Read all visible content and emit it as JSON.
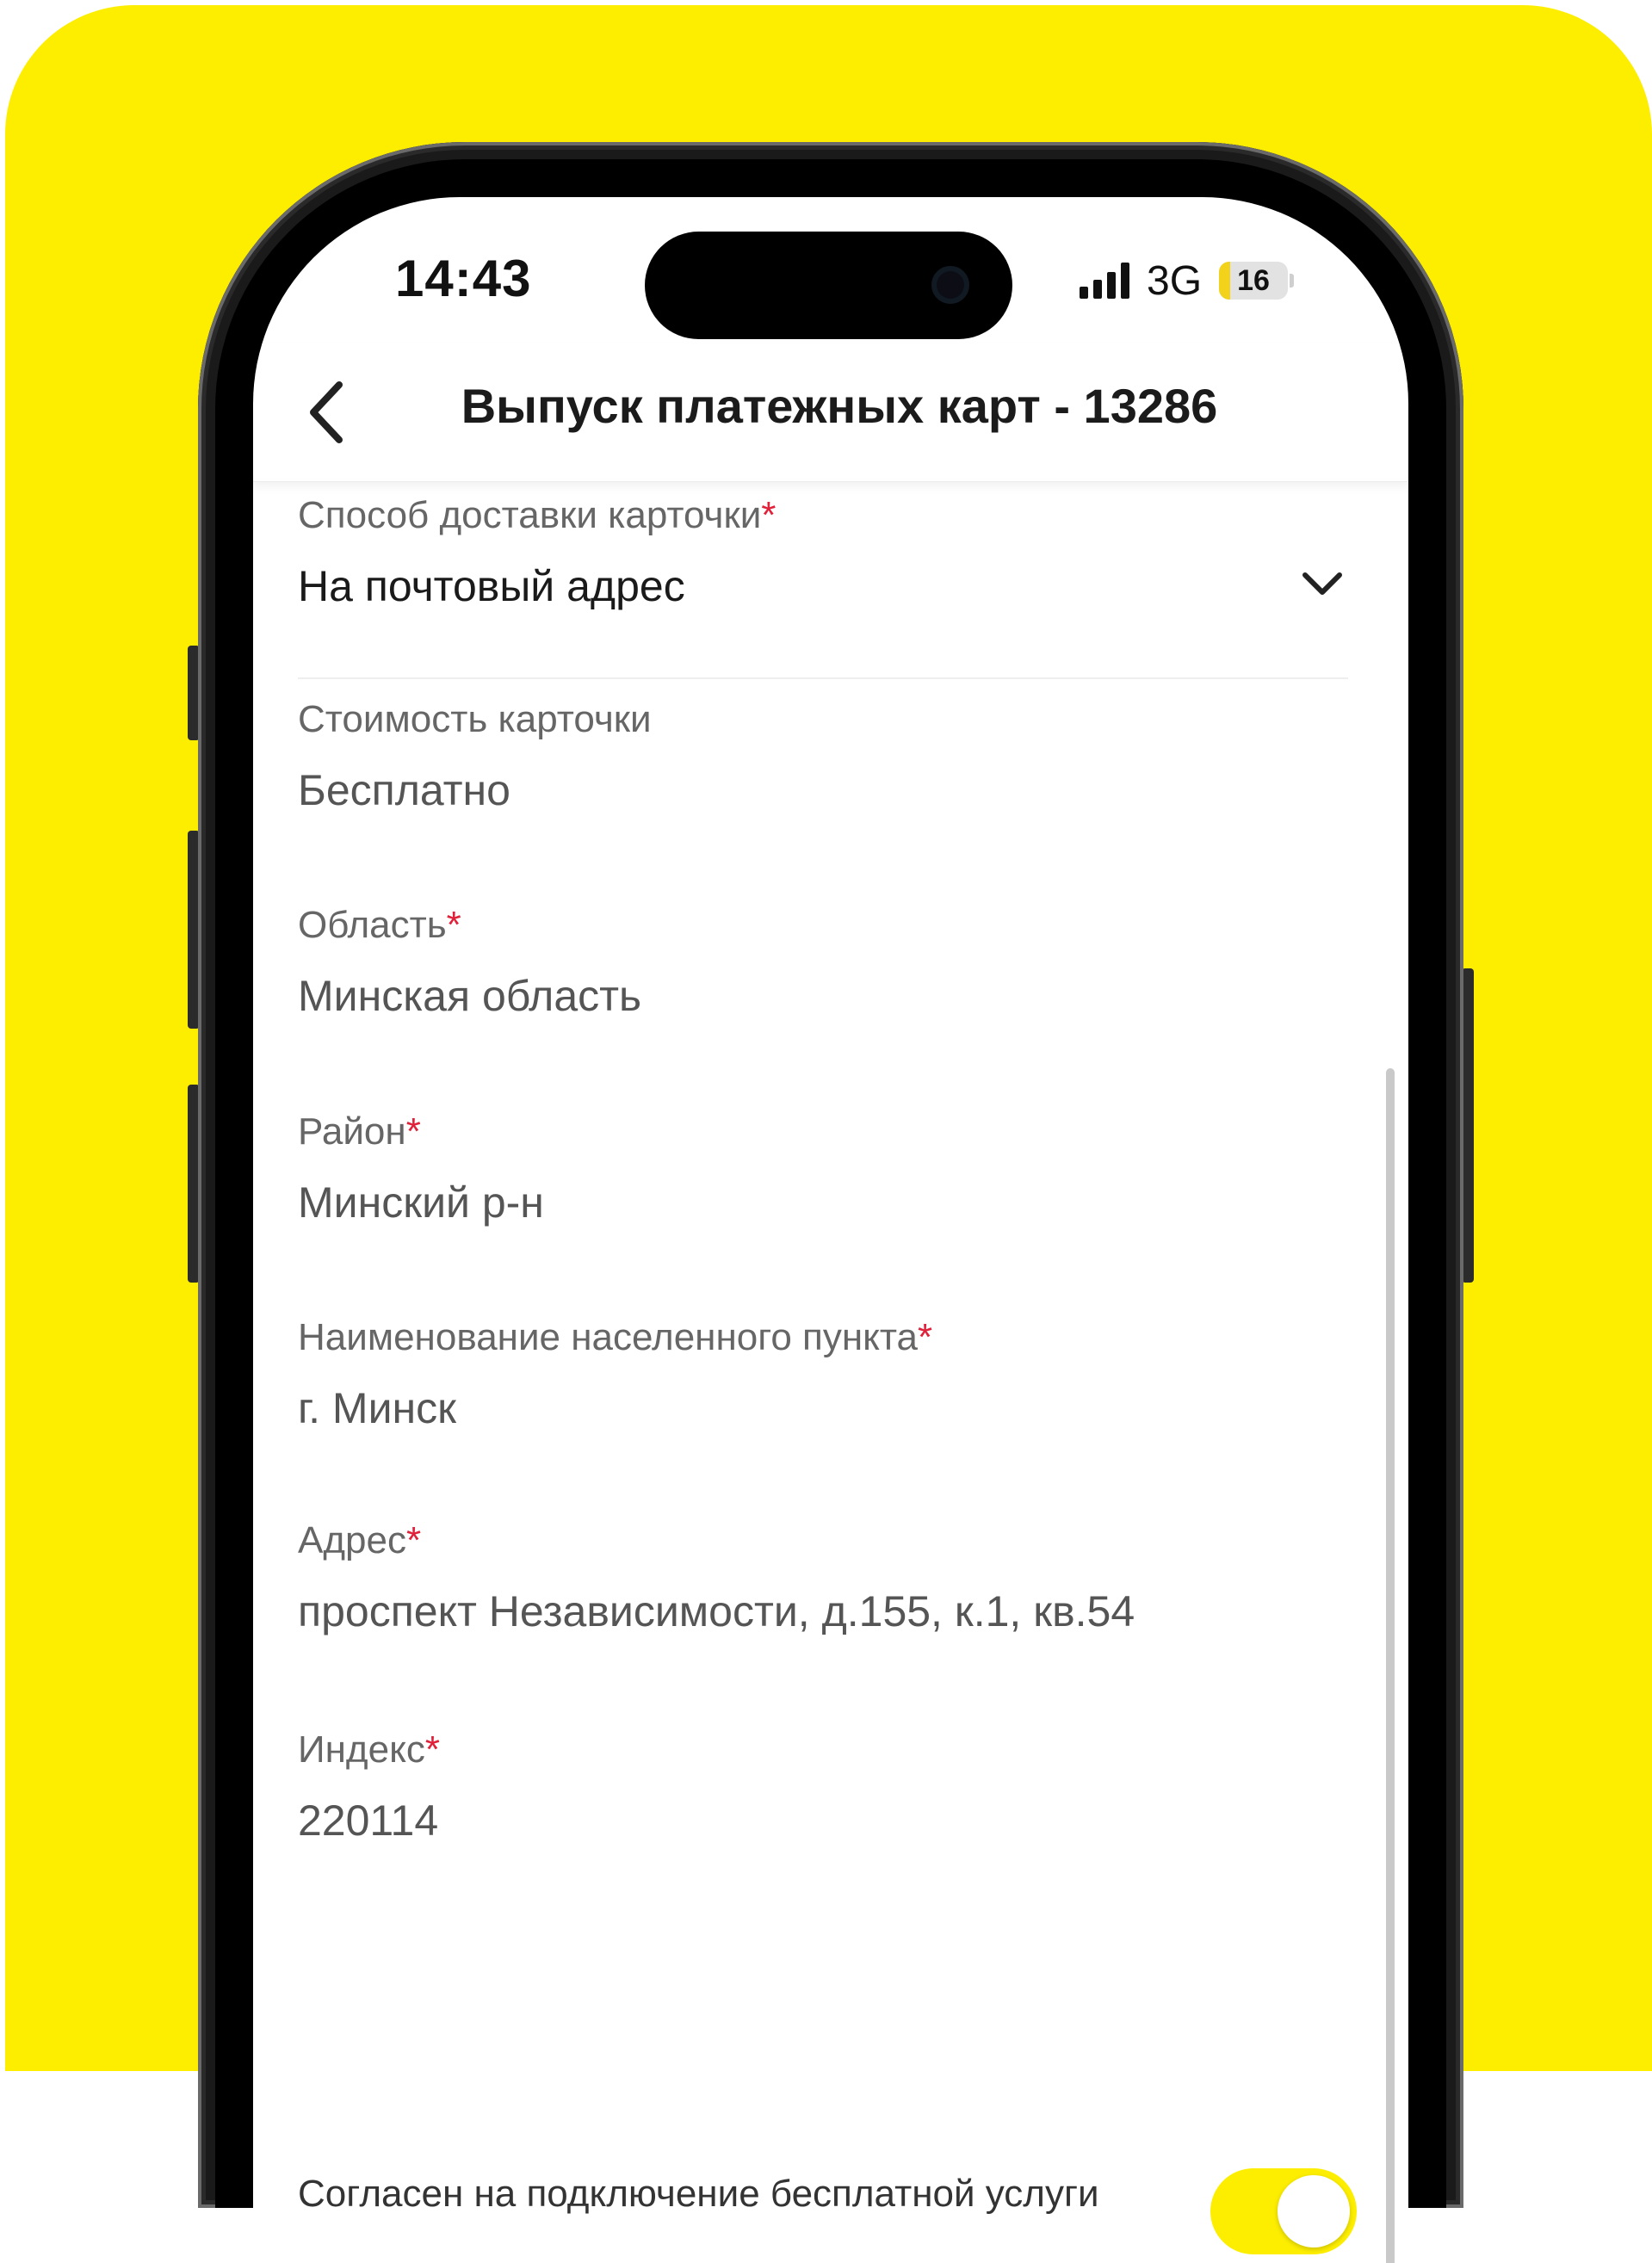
{
  "colors": {
    "brand": "#FDEE00",
    "required": "#e0213a"
  },
  "status_bar": {
    "time": "14:43",
    "network": "3G",
    "battery": "16",
    "battery_level": 0.16
  },
  "header": {
    "back_icon": "chevron-left-icon",
    "title": "Выпуск платежных карт - 13286"
  },
  "form": {
    "delivery": {
      "label": "Способ доставки карточки",
      "required_mark": "*",
      "value": "На почтовый адрес",
      "icon": "chevron-down-icon"
    },
    "cost": {
      "label": "Стоимость карточки",
      "value": "Бесплатно"
    },
    "region": {
      "label": "Область",
      "required_mark": "*",
      "value": "Минская область"
    },
    "district": {
      "label": "Район",
      "required_mark": "*",
      "value": "Минский р-н"
    },
    "locality": {
      "label": "Наименование населенного пункта",
      "required_mark": "*",
      "value": "г. Минск"
    },
    "address": {
      "label": "Адрес",
      "required_mark": "*",
      "value": "проспект Независимости, д.155, к.1, кв.54"
    },
    "postcode": {
      "label": "Индекс",
      "required_mark": "*",
      "value": "220114"
    },
    "consent": {
      "label": "Согласен на подключение бесплатной услуги",
      "checked": true
    }
  }
}
